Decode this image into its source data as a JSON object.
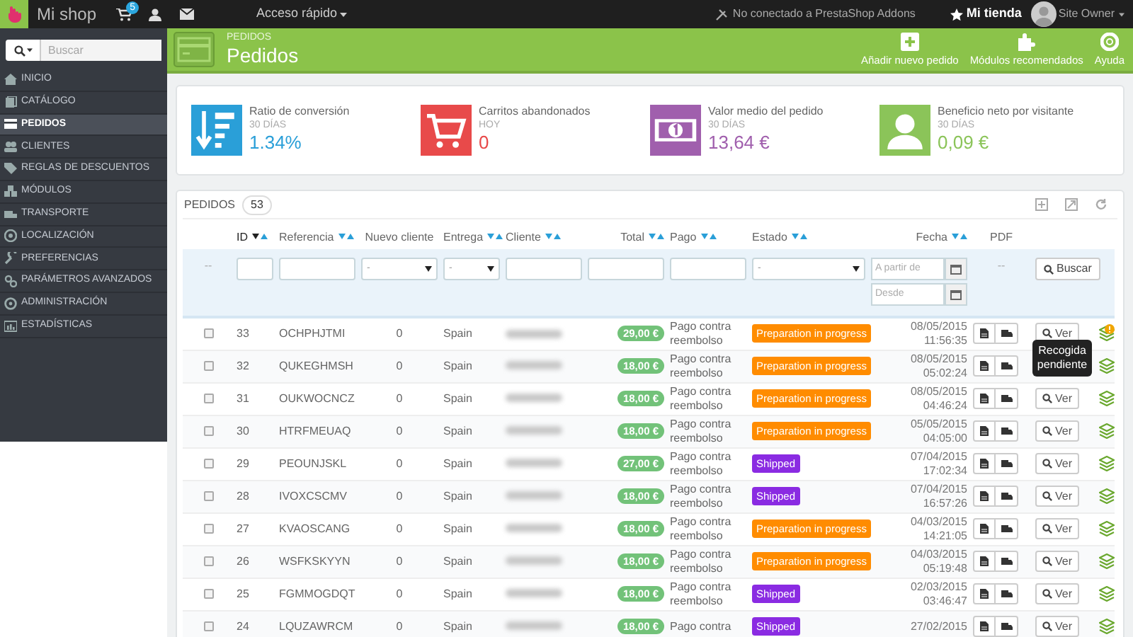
{
  "topbar": {
    "shop_name": "Mi shop",
    "cart_badge": "5",
    "quick_access": "Acceso rápido",
    "addons_status": "No conectado a PrestaShop Addons",
    "store_link": "Mi tienda",
    "user": "Site Owner"
  },
  "sidebar": {
    "search_placeholder": "Buscar",
    "items": [
      {
        "label": "INICIO",
        "selected": false
      },
      {
        "label": "CATÁLOGO",
        "selected": false
      },
      {
        "label": "PEDIDOS",
        "selected": true
      },
      {
        "label": "CLIENTES",
        "selected": false
      },
      {
        "label": "REGLAS DE DESCUENTOS",
        "selected": false
      },
      {
        "label": "MÓDULOS",
        "selected": false
      },
      {
        "label": "TRANSPORTE",
        "selected": false
      },
      {
        "label": "LOCALIZACIÓN",
        "selected": false
      },
      {
        "label": "PREFERENCIAS",
        "selected": false
      },
      {
        "label": "PARÁMETROS AVANZADOS",
        "selected": false
      },
      {
        "label": "ADMINISTRACIÓN",
        "selected": false
      },
      {
        "label": "ESTADÍSTICAS",
        "selected": false
      }
    ]
  },
  "header": {
    "breadcrumb": "PEDIDOS",
    "title": "Pedidos",
    "actions": [
      {
        "kind": "add",
        "label": "Añadir nuevo pedido"
      },
      {
        "kind": "modules",
        "label": "Módulos recomendados"
      },
      {
        "kind": "help",
        "label": "Ayuda"
      }
    ]
  },
  "kpis": [
    {
      "kind": "conversion",
      "title": "Ratio de conversión",
      "period": "30 DÍAS",
      "value": "1.34%",
      "color": "#2a9fd8"
    },
    {
      "kind": "cart",
      "title": "Carritos abandonados",
      "period": "HOY",
      "value": "0",
      "color": "#e84a4a"
    },
    {
      "kind": "money",
      "title": "Valor medio del pedido",
      "period": "30 DÍAS",
      "value": "13,64 €",
      "color": "#a05fad"
    },
    {
      "kind": "user",
      "title": "Beneficio neto por visitante",
      "period": "30 DÍAS",
      "value": "0,09 €",
      "color": "#8bc459"
    }
  ],
  "orders": {
    "title": "PEDIDOS",
    "count": "53",
    "columns": [
      {
        "label": "ID",
        "sortable": true,
        "sorted": true
      },
      {
        "label": "Referencia",
        "sortable": true,
        "sorted": false
      },
      {
        "label": "Nuevo cliente",
        "sortable": false,
        "sorted": false
      },
      {
        "label": "Entrega",
        "sortable": true,
        "sorted": false
      },
      {
        "label": "Cliente",
        "sortable": true,
        "sorted": false
      },
      {
        "label": "Total",
        "sortable": true,
        "sorted": false
      },
      {
        "label": "Pago",
        "sortable": true,
        "sorted": false
      },
      {
        "label": "Estado",
        "sortable": true,
        "sorted": false
      },
      {
        "label": "Fecha",
        "sortable": true,
        "sorted": false
      },
      {
        "label": "PDF",
        "sortable": false,
        "sorted": false
      }
    ],
    "filters": {
      "reset": "--",
      "select_value": "-",
      "date_from_placeholder": "A partir de",
      "date_to_placeholder": "Desde",
      "pdf": "--",
      "search_button": "Buscar"
    },
    "rows": [
      {
        "checked": false,
        "id": "33",
        "reference": "OCHPHJTMI",
        "new_customer": "0",
        "delivery": "Spain",
        "total": "29,00 €",
        "payment": "Pago contra reembolso",
        "status": {
          "label": "Preparation in progress",
          "color": "#ff8c00"
        },
        "date": "08/05/2015",
        "time": "11:56:35",
        "view": "Ver",
        "warning": true
      },
      {
        "checked": false,
        "id": "32",
        "reference": "QUKEGHMSH",
        "new_customer": "0",
        "delivery": "Spain",
        "total": "18,00 €",
        "payment": "Pago contra reembolso",
        "status": {
          "label": "Preparation in progress",
          "color": "#ff8c00"
        },
        "date": "08/05/2015",
        "time": "05:02:24",
        "warning": false
      },
      {
        "checked": false,
        "id": "31",
        "reference": "OUKWOCNCZ",
        "new_customer": "0",
        "delivery": "Spain",
        "total": "18,00 €",
        "payment": "Pago contra reembolso",
        "status": {
          "label": "Preparation in progress",
          "color": "#ff8c00"
        },
        "date": "08/05/2015",
        "time": "04:46:24",
        "view": "Ver",
        "warning": false
      },
      {
        "checked": false,
        "id": "30",
        "reference": "HTRFMEUAQ",
        "new_customer": "0",
        "delivery": "Spain",
        "total": "18,00 €",
        "payment": "Pago contra reembolso",
        "status": {
          "label": "Preparation in progress",
          "color": "#ff8c00"
        },
        "date": "05/05/2015",
        "time": "04:05:00",
        "view": "Ver",
        "warning": false
      },
      {
        "checked": false,
        "id": "29",
        "reference": "PEOUNJSKL",
        "new_customer": "0",
        "delivery": "Spain",
        "total": "27,00 €",
        "payment": "Pago contra reembolso",
        "status": {
          "label": "Shipped",
          "color": "#8a2be2"
        },
        "date": "07/04/2015",
        "time": "17:02:34",
        "view": "Ver",
        "warning": false
      },
      {
        "checked": false,
        "id": "28",
        "reference": "IVOXCSCMV",
        "new_customer": "0",
        "delivery": "Spain",
        "total": "18,00 €",
        "payment": "Pago contra reembolso",
        "status": {
          "label": "Shipped",
          "color": "#8a2be2"
        },
        "date": "07/04/2015",
        "time": "16:57:26",
        "view": "Ver",
        "warning": false
      },
      {
        "checked": false,
        "id": "27",
        "reference": "KVAOSCANG",
        "new_customer": "0",
        "delivery": "Spain",
        "total": "18,00 €",
        "payment": "Pago contra reembolso",
        "status": {
          "label": "Preparation in progress",
          "color": "#ff8c00"
        },
        "date": "04/03/2015",
        "time": "14:21:05",
        "view": "Ver",
        "warning": false
      },
      {
        "checked": false,
        "id": "26",
        "reference": "WSFKSKYYN",
        "new_customer": "0",
        "delivery": "Spain",
        "total": "18,00 €",
        "payment": "Pago contra reembolso",
        "status": {
          "label": "Preparation in progress",
          "color": "#ff8c00"
        },
        "date": "04/03/2015",
        "time": "05:19:48",
        "view": "Ver",
        "warning": false
      },
      {
        "checked": false,
        "id": "25",
        "reference": "FGMMOGDQT",
        "new_customer": "0",
        "delivery": "Spain",
        "total": "18,00 €",
        "payment": "Pago contra reembolso",
        "status": {
          "label": "Shipped",
          "color": "#8a2be2"
        },
        "date": "02/03/2015",
        "time": "03:46:47",
        "view": "Ver",
        "warning": false
      },
      {
        "checked": false,
        "id": "24",
        "reference": "LQUZAWRCM",
        "new_customer": "0",
        "delivery": "Spain",
        "total": "18,00 €",
        "payment": "Pago contra",
        "status": {
          "label": "Shipped",
          "color": "#8a2be2"
        },
        "date": "27/02/2015",
        "view": "Ver",
        "warning": false
      }
    ],
    "tooltip": "Recogida pendiente"
  }
}
